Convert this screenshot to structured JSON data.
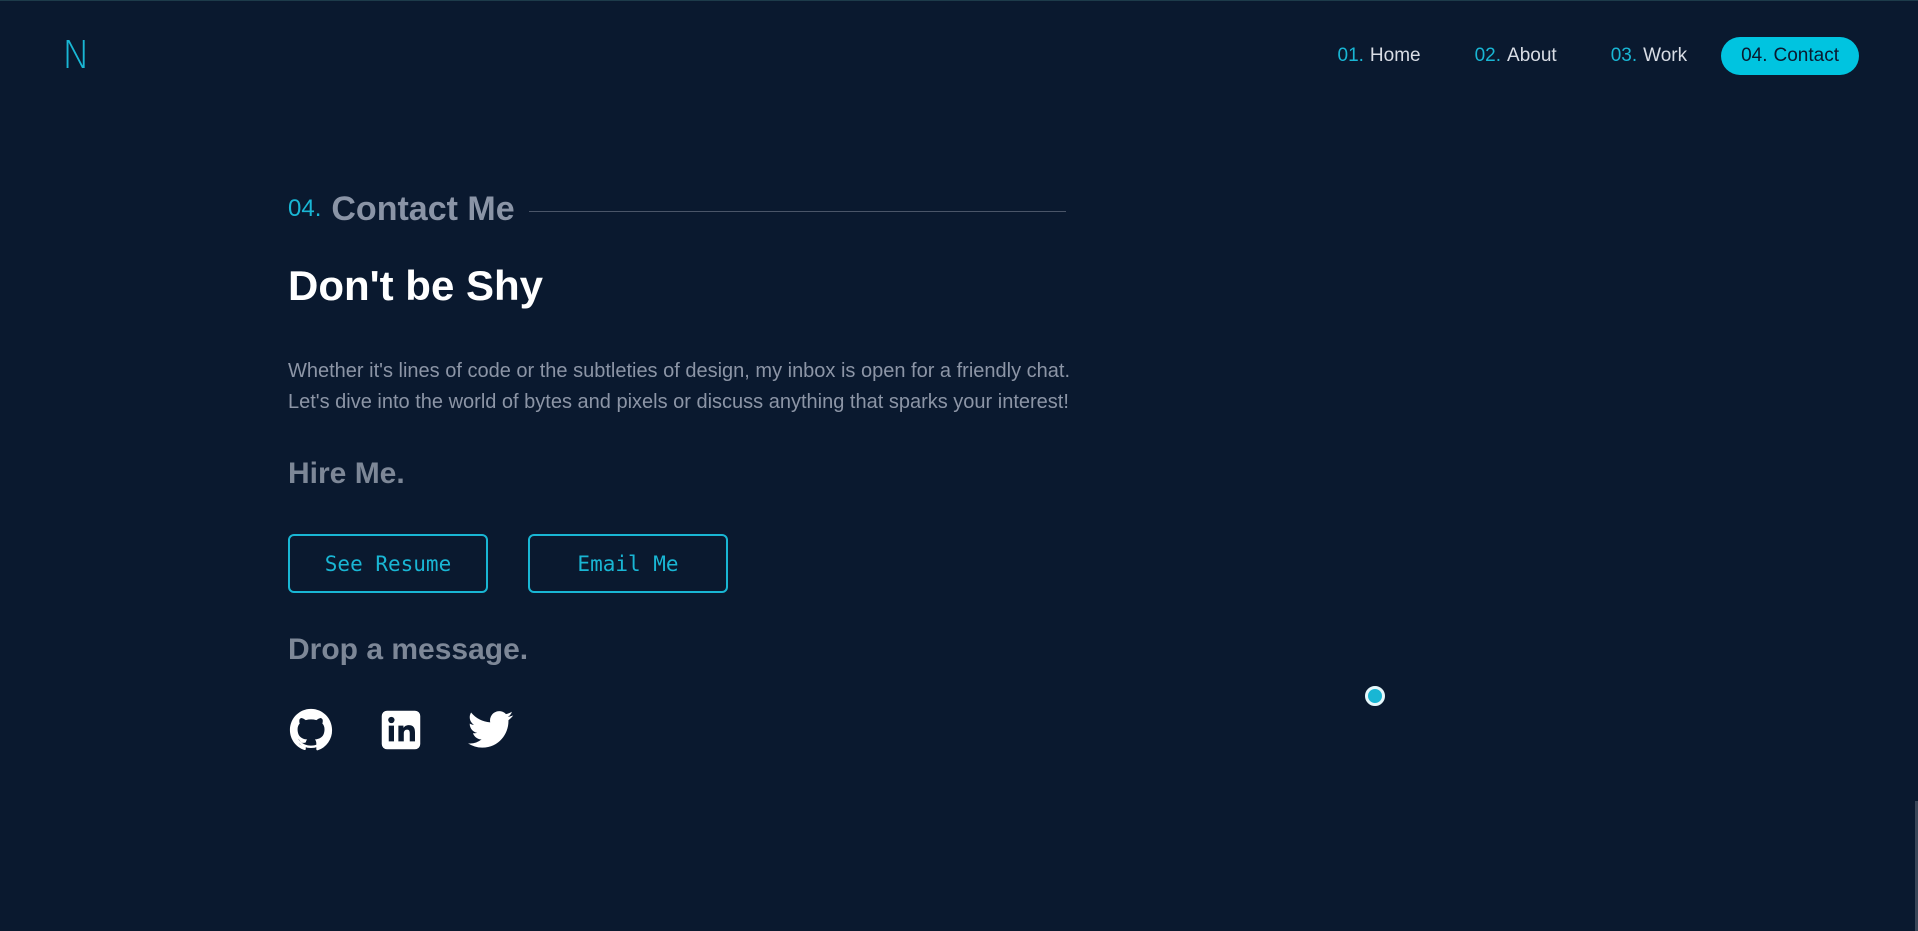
{
  "logo": {
    "letter": "N"
  },
  "nav": {
    "items": [
      {
        "num": "01.",
        "label": "Home"
      },
      {
        "num": "02.",
        "label": "About"
      },
      {
        "num": "03.",
        "label": "Work"
      },
      {
        "num": "04.",
        "label": "Contact"
      }
    ]
  },
  "contact": {
    "section_num": "04.",
    "section_title": "Contact Me",
    "headline": "Don't be Shy",
    "paragraph_line1": "Whether it's lines of code or the subtleties of design, my inbox is open for a friendly chat.",
    "paragraph_line2": "Let's dive into the world of bytes and pixels or discuss anything that sparks your interest!",
    "hire_heading": "Hire Me.",
    "resume_button": "See Resume",
    "email_button": "Email Me",
    "drop_heading": "Drop a message."
  },
  "social": [
    {
      "icon": "github-icon"
    },
    {
      "icon": "linkedin-icon"
    },
    {
      "icon": "twitter-icon"
    }
  ],
  "colors": {
    "background": "#0a192f",
    "accent": "#19b6d4",
    "active_nav_bg": "#00c4e0"
  }
}
